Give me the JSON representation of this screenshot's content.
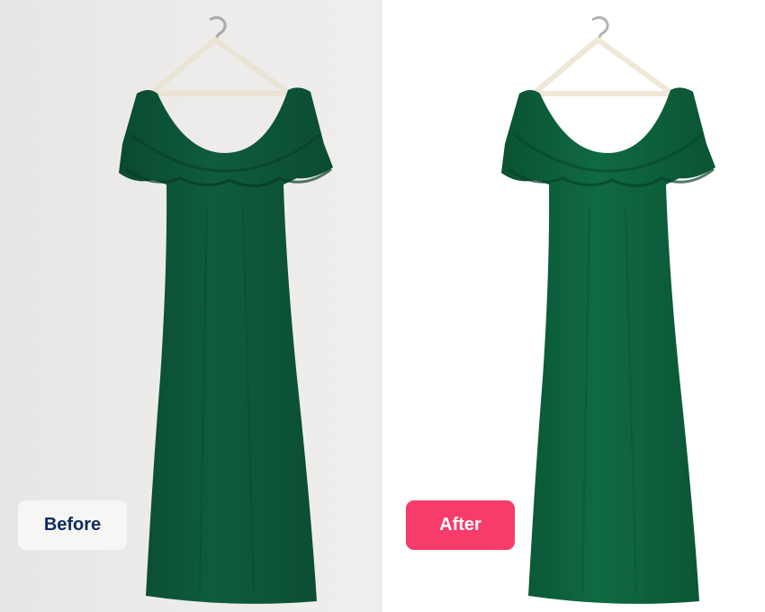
{
  "labels": {
    "before": "Before",
    "after": "After"
  },
  "colors": {
    "dress": "#0d5b3a",
    "before_background": "#ebeae8",
    "after_background": "#ffffff",
    "before_badge_bg": "#f6f6f5",
    "before_badge_text": "#102a5c",
    "after_badge_bg": "#f73b6b",
    "after_badge_text": "#ffffff"
  }
}
